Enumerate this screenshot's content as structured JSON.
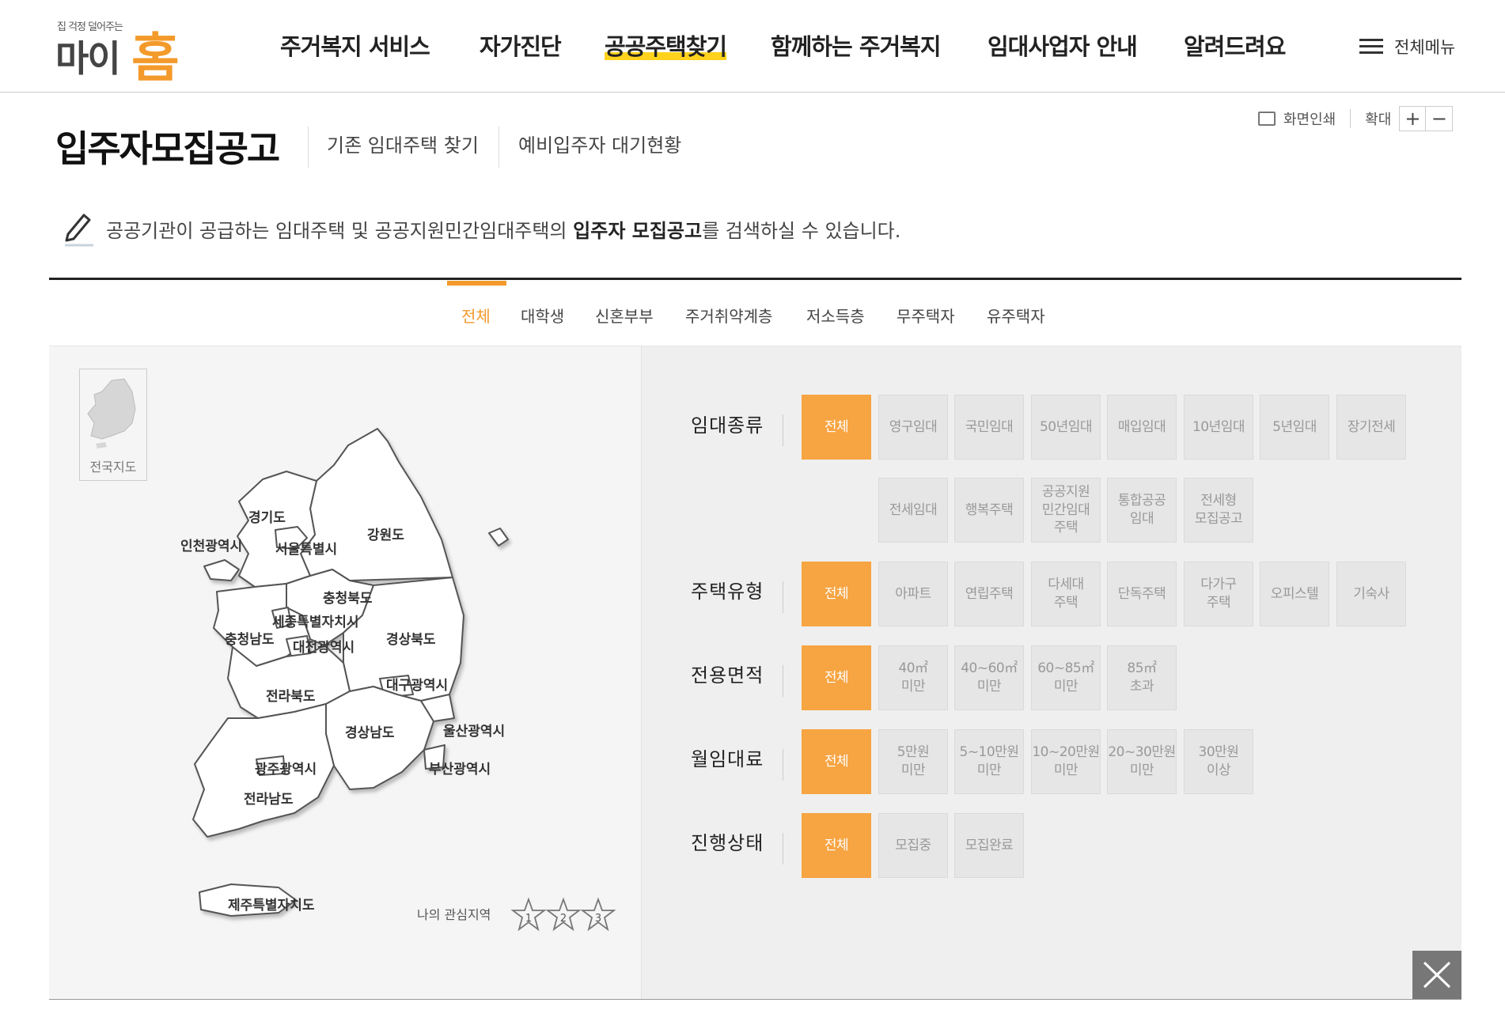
{
  "logo": {
    "tagline": "집 걱정 덜어주는",
    "mai": "마이",
    "home": "홈"
  },
  "nav": [
    "주거복지 서비스",
    "자가진단",
    "공공주택찾기",
    "함께하는 주거복지",
    "임대사업자 안내",
    "알려드려요"
  ],
  "allmenu": "전체메뉴",
  "page": {
    "title": "입주자모집공고",
    "sublinks": [
      "기존 임대주택 찾기",
      "예비입주자 대기현황"
    ],
    "print": "화면인쇄",
    "zoom": "확대",
    "zoom_in": "+",
    "zoom_out": "−",
    "desc_pre": "공공기관이 공급하는 임대주택 및 공공지원민간임대주택의 ",
    "desc_bold": "입주자 모집공고",
    "desc_post": "를 검색하실 수 있습니다."
  },
  "tabs": [
    "전체",
    "대학생",
    "신혼부부",
    "주거취약계층",
    "저소득층",
    "무주택자",
    "유주택자"
  ],
  "map": {
    "nation_label": "전국지도",
    "regions": [
      "경기도",
      "인천광역시",
      "서울특별시",
      "강원도",
      "충청북도",
      "세종특별자치시",
      "충청남도",
      "대전광역시",
      "경상북도",
      "대구광역시",
      "전라북도",
      "울산광역시",
      "경상남도",
      "광주광역시",
      "부산광역시",
      "전라남도",
      "제주특별자치도"
    ],
    "fav_label": "나의 관심지역",
    "fav_stars": [
      "1",
      "2",
      "3"
    ]
  },
  "filters": {
    "rent_type": {
      "label": "임대종류",
      "options": [
        "전체",
        "영구임대",
        "국민임대",
        "50년임대",
        "매입임대",
        "10년임대",
        "5년임대",
        "장기전세",
        "전세임대",
        "행복주택",
        "공공지원\n민간임대\n주택",
        "통합공공\n임대",
        "전세형\n모집공고"
      ]
    },
    "house_type": {
      "label": "주택유형",
      "options": [
        "전체",
        "아파트",
        "연립주택",
        "다세대\n주택",
        "단독주택",
        "다가구\n주택",
        "오피스텔",
        "기숙사"
      ]
    },
    "area": {
      "label": "전용면적",
      "options": [
        "전체",
        "40㎡\n미만",
        "40~60㎡\n미만",
        "60~85㎡\n미만",
        "85㎡\n초과"
      ]
    },
    "rent": {
      "label": "월임대료",
      "options": [
        "전체",
        "5만원\n미만",
        "5~10만원\n미만",
        "10~20만원\n미만",
        "20~30만원\n미만",
        "30만원\n이상"
      ]
    },
    "status": {
      "label": "진행상태",
      "options": [
        "전체",
        "모집중",
        "모집완료"
      ]
    }
  },
  "colors": {
    "accent": "#f7a442",
    "highlight": "#ffd21e",
    "close_bg": "#777777"
  }
}
